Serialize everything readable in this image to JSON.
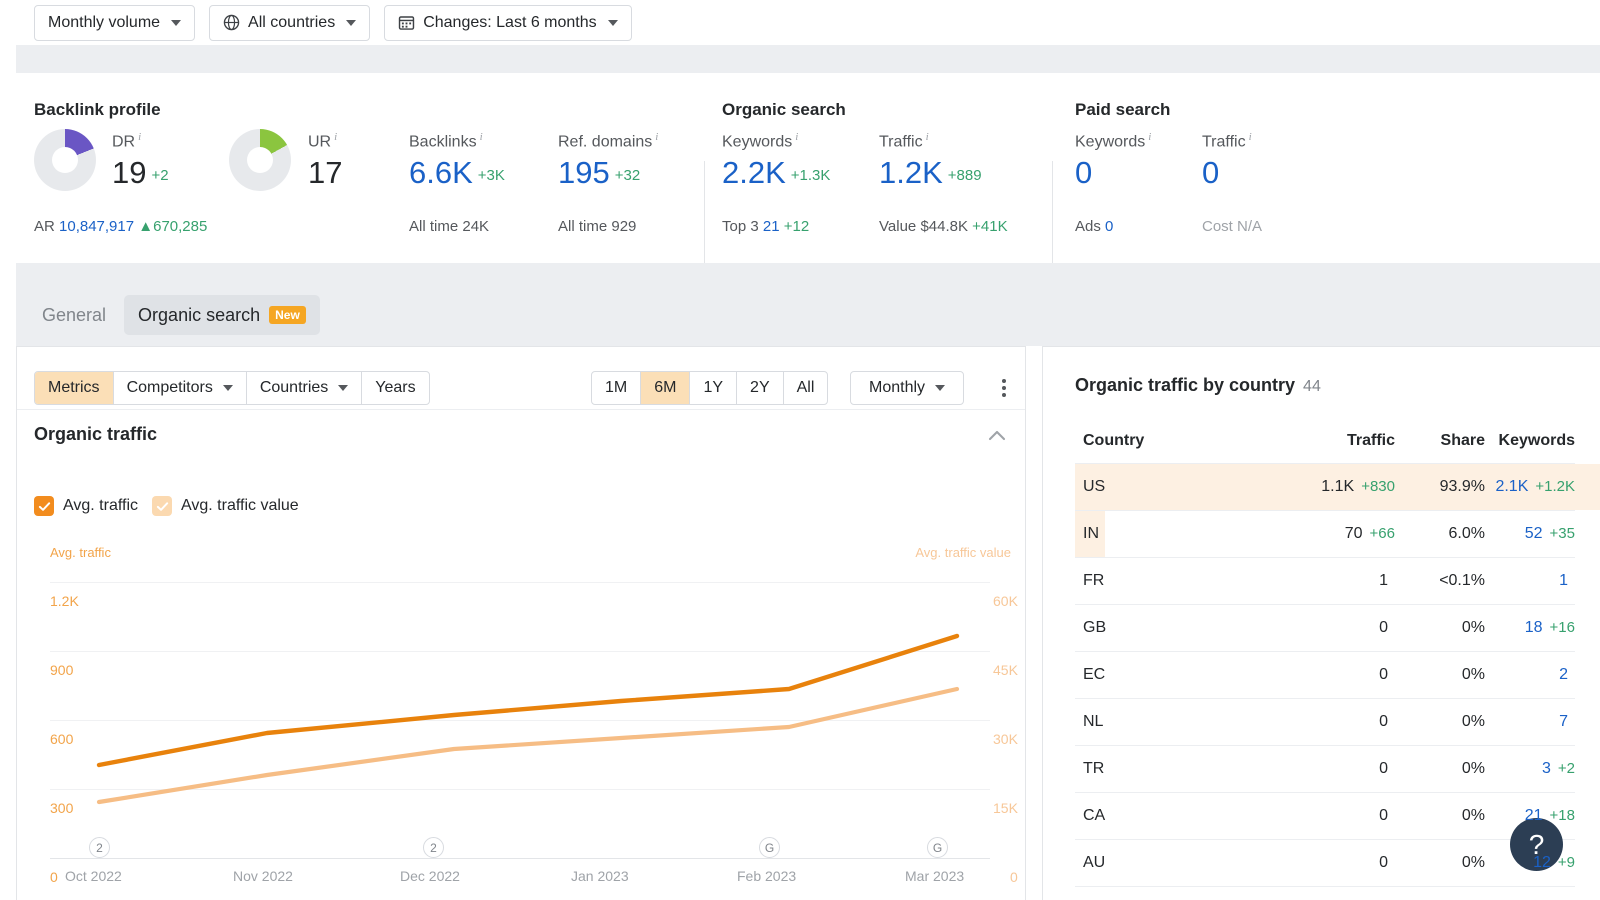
{
  "filters": [
    {
      "label": "Monthly volume",
      "icon": "none",
      "caret": true
    },
    {
      "label": "All countries",
      "icon": "globe-icon",
      "caret": true
    },
    {
      "label": "Changes: Last 6 months",
      "icon": "calendar-icon",
      "caret": true
    }
  ],
  "metrics": {
    "groups": [
      {
        "title": "Backlink profile"
      },
      {
        "title": "Organic search"
      },
      {
        "title": "Paid search"
      }
    ],
    "dr": {
      "label": "DR",
      "value": "19",
      "delta": "+2",
      "donut_percent": 19,
      "donut_color": "#6a56c4"
    },
    "ur": {
      "label": "UR",
      "value": "17",
      "delta": "",
      "donut_percent": 17,
      "donut_color": "#8bc53f"
    },
    "ar": {
      "prefix": "AR",
      "value": "10,847,917",
      "delta": "▲670,285"
    },
    "backlinks": {
      "label": "Backlinks",
      "value": "6.6K",
      "delta": "+3K",
      "sub_label": "All time",
      "sub_value": "24K"
    },
    "refdomains": {
      "label": "Ref. domains",
      "value": "195",
      "delta": "+32",
      "sub_label": "All time",
      "sub_value": "929"
    },
    "org_keywords": {
      "label": "Keywords",
      "value": "2.2K",
      "delta": "+1.3K",
      "sub_label": "Top 3",
      "sub_value": "21",
      "sub_delta": "+12"
    },
    "org_traffic": {
      "label": "Traffic",
      "value": "1.2K",
      "delta": "+889",
      "sub_label": "Value",
      "sub_value": "$44.8K",
      "sub_delta": "+41K"
    },
    "paid_keywords": {
      "label": "Keywords",
      "value": "0",
      "delta": "",
      "sub_label": "Ads",
      "sub_value": "0"
    },
    "paid_traffic": {
      "label": "Traffic",
      "value": "0",
      "delta": "",
      "sub_label": "Cost",
      "sub_value": "N/A"
    }
  },
  "tabs": [
    {
      "label": "General",
      "active": false,
      "badge": ""
    },
    {
      "label": "Organic search",
      "active": true,
      "badge": "New"
    }
  ],
  "toolbar": {
    "left_group": [
      {
        "label": "Metrics",
        "active": true,
        "caret": false
      },
      {
        "label": "Competitors",
        "active": false,
        "caret": true
      },
      {
        "label": "Countries",
        "active": false,
        "caret": true
      },
      {
        "label": "Years",
        "active": false,
        "caret": false
      }
    ],
    "range_group": [
      {
        "label": "1M",
        "active": false
      },
      {
        "label": "6M",
        "active": true
      },
      {
        "label": "1Y",
        "active": false
      },
      {
        "label": "2Y",
        "active": false
      },
      {
        "label": "All",
        "active": false
      }
    ],
    "granularity": {
      "label": "Monthly",
      "caret": true
    },
    "kebab": "more-options"
  },
  "chart_panel": {
    "title": "Organic traffic",
    "collapse_icon": "chevron-up-icon",
    "legend": [
      {
        "label": "Avg. traffic",
        "checked": true,
        "color": "#ef8212"
      },
      {
        "label": "Avg. traffic value",
        "checked": true,
        "color": "#f6c08a"
      }
    ]
  },
  "chart_data": {
    "type": "line",
    "title": "Organic traffic",
    "xlabel": "",
    "grid": true,
    "legend_position": "top-left",
    "x": [
      "Oct 2022",
      "Nov 2022",
      "Dec 2022",
      "Jan 2023",
      "Feb 2023",
      "Mar 2023"
    ],
    "x_markers": [
      {
        "x": "Oct 2022",
        "label": "2"
      },
      {
        "x": "Dec 2022",
        "label": "2"
      },
      {
        "x": "Feb 2023",
        "label": "G"
      },
      {
        "x": "Mar 2023",
        "label": "G"
      }
    ],
    "axes": {
      "left": {
        "name": "Avg. traffic",
        "ticks": [
          "0",
          "300",
          "600",
          "900",
          "1.2K"
        ],
        "min": 0,
        "max": 1500,
        "color": "#ef8212"
      },
      "right": {
        "name": "Avg. traffic value",
        "ticks": [
          "0",
          "15K",
          "30K",
          "45K",
          "60K"
        ],
        "min": 0,
        "max": 75000,
        "color": "#f6c08a"
      }
    },
    "series": [
      {
        "name": "Avg. traffic",
        "color": "#ef8212",
        "axis": "left",
        "values": [
          505,
          680,
          780,
          855,
          920,
          1205
        ]
      },
      {
        "name": "Avg. traffic value",
        "color": "#f6c08a",
        "axis": "right",
        "values": [
          15200,
          22500,
          29500,
          32500,
          35500,
          46000
        ]
      }
    ]
  },
  "country_panel": {
    "title": "Organic traffic by country",
    "count": "44",
    "columns": [
      "Country",
      "Traffic",
      "Share",
      "Keywords"
    ],
    "rows": [
      {
        "country": "US",
        "traffic": "1.1K",
        "traffic_delta": "+830",
        "share": "93.9%",
        "share_pct": 93.9,
        "keywords": "2.1K",
        "keywords_delta": "+1.2K",
        "highlight": true
      },
      {
        "country": "IN",
        "traffic": "70",
        "traffic_delta": "+66",
        "share": "6.0%",
        "share_pct": 6.0,
        "keywords": "52",
        "keywords_delta": "+35",
        "highlight": true
      },
      {
        "country": "FR",
        "traffic": "1",
        "traffic_delta": "",
        "share": "<0.1%",
        "share_pct": 0.1,
        "keywords": "1",
        "keywords_delta": "",
        "highlight": false
      },
      {
        "country": "GB",
        "traffic": "0",
        "traffic_delta": "",
        "share": "0%",
        "share_pct": 0,
        "keywords": "18",
        "keywords_delta": "+16",
        "highlight": false
      },
      {
        "country": "EC",
        "traffic": "0",
        "traffic_delta": "",
        "share": "0%",
        "share_pct": 0,
        "keywords": "2",
        "keywords_delta": "",
        "highlight": false
      },
      {
        "country": "NL",
        "traffic": "0",
        "traffic_delta": "",
        "share": "0%",
        "share_pct": 0,
        "keywords": "7",
        "keywords_delta": "",
        "highlight": false
      },
      {
        "country": "TR",
        "traffic": "0",
        "traffic_delta": "",
        "share": "0%",
        "share_pct": 0,
        "keywords": "3",
        "keywords_delta": "+2",
        "highlight": false
      },
      {
        "country": "CA",
        "traffic": "0",
        "traffic_delta": "",
        "share": "0%",
        "share_pct": 0,
        "keywords": "21",
        "keywords_delta": "+18",
        "highlight": false
      },
      {
        "country": "AU",
        "traffic": "0",
        "traffic_delta": "",
        "share": "0%",
        "share_pct": 0,
        "keywords": "12",
        "keywords_delta": "+9",
        "highlight": false
      }
    ]
  },
  "help_button": {
    "label": "?"
  }
}
